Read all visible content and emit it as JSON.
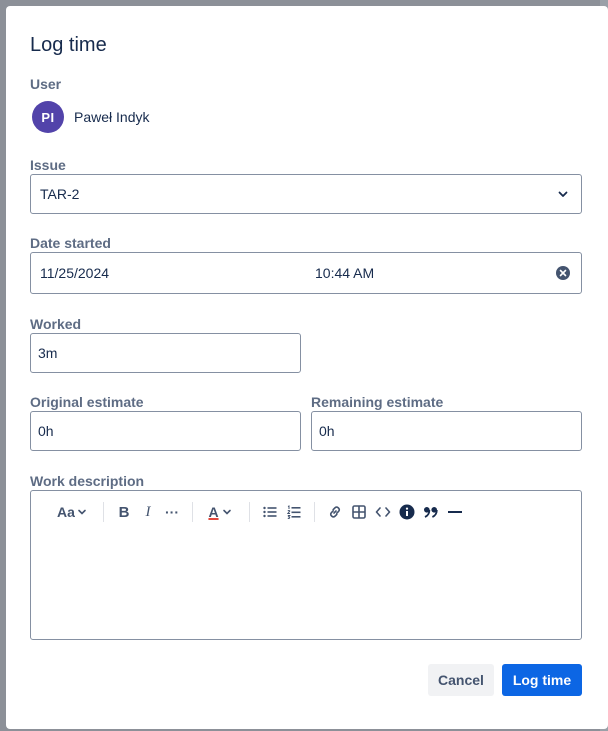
{
  "dialog": {
    "title": "Log time",
    "user": {
      "label": "User",
      "initials": "PI",
      "name": "Paweł Indyk"
    },
    "issue": {
      "label": "Issue",
      "value": "TAR-2"
    },
    "date_started": {
      "label": "Date started",
      "date": "11/25/2024",
      "time": "10:44 AM"
    },
    "worked": {
      "label": "Worked",
      "value": "3m"
    },
    "original_estimate": {
      "label": "Original estimate",
      "value": "0h"
    },
    "remaining_estimate": {
      "label": "Remaining estimate",
      "value": "0h"
    },
    "work_description": {
      "label": "Work description",
      "toolbar": {
        "text_style": "Aa",
        "bold": "B",
        "italic": "I",
        "more": "···",
        "text_color": "A"
      }
    },
    "buttons": {
      "cancel": "Cancel",
      "log_time": "Log time"
    },
    "colors": {
      "primary": "#0c66e4",
      "avatar": "#5243aa"
    }
  }
}
